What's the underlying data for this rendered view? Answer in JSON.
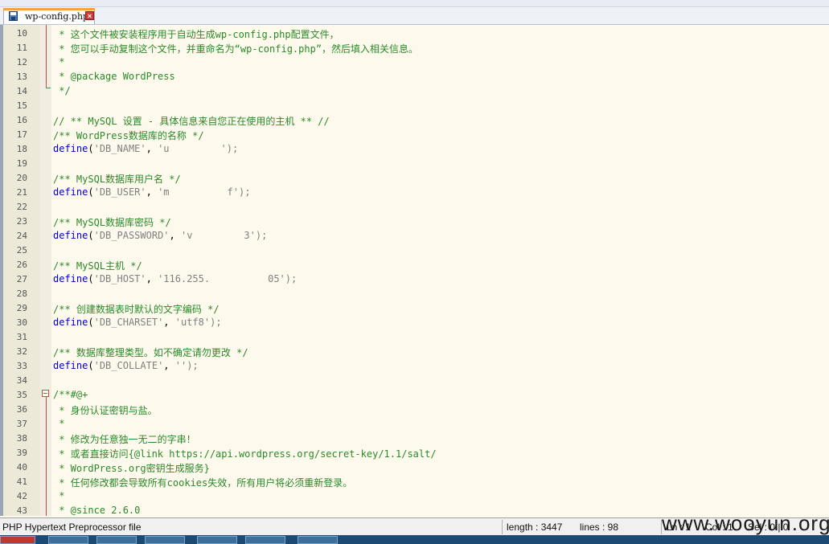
{
  "tab": {
    "label": "wp-config.php"
  },
  "editor": {
    "lines": [
      {
        "n": "10",
        "kind": "comment",
        "text": " * 这个文件被安装程序用于自动生成wp-config.php配置文件，"
      },
      {
        "n": "11",
        "kind": "comment",
        "text": " * 您可以手动复制这个文件，并重命名为“wp-config.php”，然后填入相关信息。"
      },
      {
        "n": "12",
        "kind": "comment",
        "text": " *"
      },
      {
        "n": "13",
        "kind": "comment",
        "text": " * @package WordPress"
      },
      {
        "n": "14",
        "kind": "comment",
        "text": " */"
      },
      {
        "n": "15",
        "kind": "blank",
        "text": ""
      },
      {
        "n": "16",
        "kind": "comment",
        "text": "// ** MySQL 设置 - 具体信息来自您正在使用的主机 ** //"
      },
      {
        "n": "17",
        "kind": "comment",
        "text": "/** WordPress数据库的名称 */"
      },
      {
        "n": "18",
        "kind": "define",
        "key": "'DB_NAME'",
        "value": "'u",
        "value_tail": "');"
      },
      {
        "n": "19",
        "kind": "blank",
        "text": ""
      },
      {
        "n": "20",
        "kind": "comment",
        "text": "/** MySQL数据库用户名 */"
      },
      {
        "n": "21",
        "kind": "define",
        "key": "'DB_USER'",
        "value": "'m",
        "value_tail": "f');"
      },
      {
        "n": "22",
        "kind": "blank",
        "text": ""
      },
      {
        "n": "23",
        "kind": "comment",
        "text": "/** MySQL数据库密码 */"
      },
      {
        "n": "24",
        "kind": "define",
        "key": "'DB_PASSWORD'",
        "value": "'v",
        "value_tail": "3');"
      },
      {
        "n": "25",
        "kind": "blank",
        "text": ""
      },
      {
        "n": "26",
        "kind": "comment",
        "text": "/** MySQL主机 */"
      },
      {
        "n": "27",
        "kind": "define",
        "key": "'DB_HOST'",
        "value": "'116.255.",
        "value_tail": "05');"
      },
      {
        "n": "28",
        "kind": "blank",
        "text": ""
      },
      {
        "n": "29",
        "kind": "comment",
        "text": "/** 创建数据表时默认的文字编码 */"
      },
      {
        "n": "30",
        "kind": "define",
        "key": "'DB_CHARSET'",
        "value": "'utf8'",
        "value_tail": ");"
      },
      {
        "n": "31",
        "kind": "blank",
        "text": ""
      },
      {
        "n": "32",
        "kind": "comment",
        "text": "/** 数据库整理类型。如不确定请勿更改 */"
      },
      {
        "n": "33",
        "kind": "define",
        "key": "'DB_COLLATE'",
        "value": "''",
        "value_tail": ");"
      },
      {
        "n": "34",
        "kind": "blank",
        "text": ""
      },
      {
        "n": "35",
        "kind": "comment",
        "text": "/**#@+"
      },
      {
        "n": "36",
        "kind": "comment",
        "text": " * 身份认证密钥与盐。"
      },
      {
        "n": "37",
        "kind": "comment",
        "text": " *"
      },
      {
        "n": "38",
        "kind": "comment",
        "text": " * 修改为任意独一无二的字串！"
      },
      {
        "n": "39",
        "kind": "comment",
        "text": " * 或者直接访问{@link https://api.wordpress.org/secret-key/1.1/salt/"
      },
      {
        "n": "40",
        "kind": "comment",
        "text": " * WordPress.org密钥生成服务}"
      },
      {
        "n": "41",
        "kind": "comment",
        "text": " * 任何修改都会导致所有cookies失效，所有用户将必须重新登录。"
      },
      {
        "n": "42",
        "kind": "comment",
        "text": " *"
      },
      {
        "n": "43",
        "kind": "comment",
        "text": " * @since 2.6.0"
      }
    ],
    "define_keyword": "define"
  },
  "status": {
    "file_type": "PHP Hypertext Preprocessor file",
    "length": "length : 3447",
    "lines": "lines : 98",
    "ln": "Ln : 1",
    "col": "Col : 1",
    "sel": "Sel : 0 | 0"
  },
  "watermark": "www.wooyun.org",
  "colors": {
    "comment": "#2a8a2a",
    "keyword": "#0000cc",
    "string": "#808080",
    "tab_accent": "#f7a23a",
    "editor_bg": "#fdf9ec"
  }
}
